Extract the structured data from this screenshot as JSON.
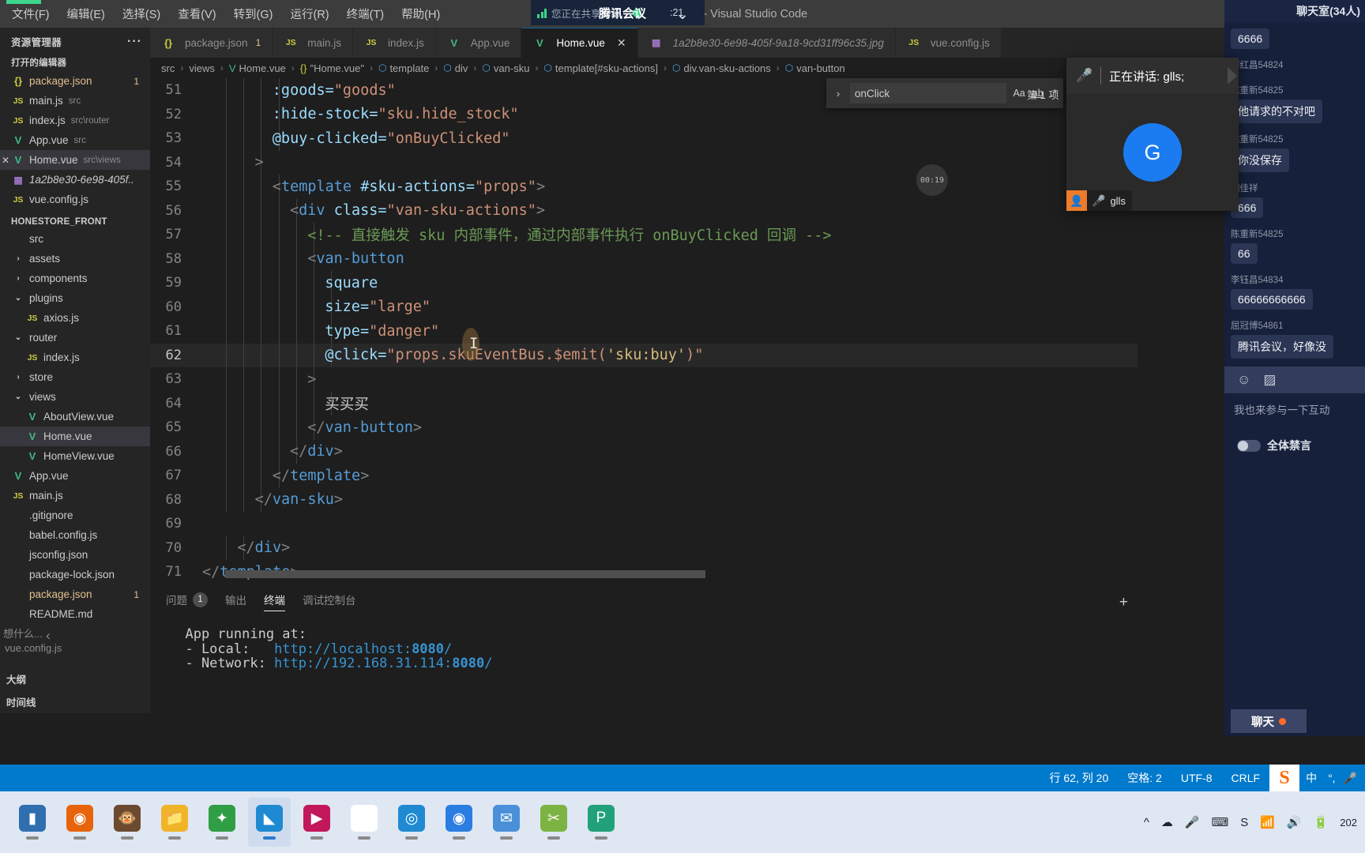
{
  "titlebar": {
    "menus": [
      "文件(F)",
      "编辑(E)",
      "选择(S)",
      "查看(V)",
      "转到(G)",
      "运行(R)",
      "终端(T)",
      "帮助(H)"
    ],
    "window_title": "Home.vue - honestore_front - Visual Studio Code",
    "minimize": "—",
    "maximize": "□",
    "close": "✕"
  },
  "meeting_pill": {
    "sharing_text": "您正在共享屏幕",
    "app_name": "腾讯会议",
    "timer": ":21",
    "chevron": "⌄"
  },
  "explorer": {
    "header": "资源管理器",
    "more": "···",
    "open_editors_label": "打开的编辑器",
    "open_editors": [
      {
        "icon": "json-icon",
        "name": "package.json",
        "desc": "",
        "badge": "1",
        "selected": false,
        "kind": "json"
      },
      {
        "icon": "js-icon",
        "name": "main.js",
        "desc": "src",
        "badge": "",
        "selected": false,
        "kind": "js"
      },
      {
        "icon": "js-icon",
        "name": "index.js",
        "desc": "src\\router",
        "badge": "",
        "selected": false,
        "kind": "js"
      },
      {
        "icon": "vue-icon",
        "name": "App.vue",
        "desc": "src",
        "badge": "",
        "selected": false,
        "kind": "vue"
      },
      {
        "icon": "vue-icon",
        "name": "Home.vue",
        "desc": "src\\views",
        "badge": "",
        "selected": true,
        "kind": "vue"
      },
      {
        "icon": "image-icon",
        "name": "1a2b8e30-6e98-405f..",
        "desc": "",
        "badge": "",
        "selected": false,
        "kind": "img"
      },
      {
        "icon": "js-icon",
        "name": "vue.config.js",
        "desc": "",
        "badge": "",
        "selected": false,
        "kind": "js"
      }
    ],
    "project_label": "HONESTORE_FRONT",
    "tree": [
      {
        "indent": 0,
        "chev": "",
        "icon": "",
        "name": "src",
        "badge": "",
        "kind": "folder",
        "selected": false
      },
      {
        "indent": 0,
        "chev": "›",
        "icon": "",
        "name": "assets",
        "badge": "",
        "kind": "folder",
        "selected": false
      },
      {
        "indent": 0,
        "chev": "›",
        "icon": "",
        "name": "components",
        "badge": "",
        "kind": "folder",
        "selected": false
      },
      {
        "indent": 0,
        "chev": "⌄",
        "icon": "",
        "name": "plugins",
        "badge": "",
        "kind": "folder",
        "selected": false
      },
      {
        "indent": 1,
        "chev": "",
        "icon": "js-icon",
        "name": "axios.js",
        "badge": "",
        "kind": "js",
        "selected": false
      },
      {
        "indent": 0,
        "chev": "⌄",
        "icon": "",
        "name": "router",
        "badge": "",
        "kind": "folder",
        "selected": false
      },
      {
        "indent": 1,
        "chev": "",
        "icon": "js-icon",
        "name": "index.js",
        "badge": "",
        "kind": "js",
        "selected": false
      },
      {
        "indent": 0,
        "chev": "›",
        "icon": "",
        "name": "store",
        "badge": "",
        "kind": "folder",
        "selected": false
      },
      {
        "indent": 0,
        "chev": "⌄",
        "icon": "",
        "name": "views",
        "badge": "",
        "kind": "folder",
        "selected": false
      },
      {
        "indent": 1,
        "chev": "",
        "icon": "vue-icon",
        "name": "AboutView.vue",
        "badge": "",
        "kind": "vue",
        "selected": false
      },
      {
        "indent": 1,
        "chev": "",
        "icon": "vue-icon",
        "name": "Home.vue",
        "badge": "",
        "kind": "vue",
        "selected": true
      },
      {
        "indent": 1,
        "chev": "",
        "icon": "vue-icon",
        "name": "HomeView.vue",
        "badge": "",
        "kind": "vue",
        "selected": false
      },
      {
        "indent": 0,
        "chev": "",
        "icon": "vue-icon",
        "name": "App.vue",
        "badge": "",
        "kind": "vue",
        "selected": false
      },
      {
        "indent": 0,
        "chev": "",
        "icon": "js-icon",
        "name": "main.js",
        "badge": "",
        "kind": "js",
        "selected": false
      },
      {
        "indent": 0,
        "chev": "",
        "icon": "",
        "name": ".gitignore",
        "badge": "",
        "kind": "plain",
        "selected": false
      },
      {
        "indent": 0,
        "chev": "",
        "icon": "",
        "name": "babel.config.js",
        "badge": "",
        "kind": "plain",
        "selected": false
      },
      {
        "indent": 0,
        "chev": "",
        "icon": "",
        "name": "jsconfig.json",
        "badge": "",
        "kind": "plain",
        "selected": false
      },
      {
        "indent": 0,
        "chev": "",
        "icon": "",
        "name": "package-lock.json",
        "badge": "",
        "kind": "plain",
        "selected": false
      },
      {
        "indent": 0,
        "chev": "",
        "icon": "",
        "name": "package.json",
        "badge": "1",
        "kind": "json",
        "selected": false
      },
      {
        "indent": 0,
        "chev": "",
        "icon": "",
        "name": "README.md",
        "badge": "",
        "kind": "plain",
        "selected": false
      }
    ],
    "bottom_sections": [
      "大纲",
      "时间线"
    ],
    "ghost_texts": [
      "想什么...",
      "vue.config.js",
      "‹"
    ]
  },
  "tabs": [
    {
      "icon": "json-icon",
      "label": "package.json",
      "badge": "1",
      "active": false,
      "closable": false
    },
    {
      "icon": "js-icon",
      "label": "main.js",
      "badge": "",
      "active": false,
      "closable": false
    },
    {
      "icon": "js-icon",
      "label": "index.js",
      "badge": "",
      "active": false,
      "closable": false
    },
    {
      "icon": "vue-icon",
      "label": "App.vue",
      "badge": "",
      "active": false,
      "closable": false
    },
    {
      "icon": "vue-icon",
      "label": "Home.vue",
      "badge": "",
      "active": true,
      "closable": true
    },
    {
      "icon": "image-icon",
      "label": "1a2b8e30-6e98-405f-9a18-9cd31ff96c35.jpg",
      "badge": "",
      "active": false,
      "closable": false
    },
    {
      "icon": "js-icon",
      "label": "vue.config.js",
      "badge": "",
      "active": false,
      "closable": false
    }
  ],
  "breadcrumb": [
    {
      "label": "src",
      "icon": ""
    },
    {
      "label": "views",
      "icon": ""
    },
    {
      "label": "Home.vue",
      "icon": "vue-icon"
    },
    {
      "label": "\"Home.vue\"",
      "icon": "json-icon"
    },
    {
      "label": "template",
      "icon": "cube-icon"
    },
    {
      "label": "div",
      "icon": "cube-icon"
    },
    {
      "label": "van-sku",
      "icon": "cube-icon"
    },
    {
      "label": "template[#sku-actions]",
      "icon": "cube-icon"
    },
    {
      "label": "div.van-sku-actions",
      "icon": "cube-icon"
    },
    {
      "label": "van-button",
      "icon": "cube-icon"
    }
  ],
  "find_widget": {
    "chevron": "›",
    "query": "onClick",
    "match_case": "Aa",
    "whole_word": "ab",
    "regex": ".*",
    "result_count": "第 1 项"
  },
  "editor": {
    "hover_tooltip": "00:19",
    "lines": [
      {
        "num": "51",
        "indent": 4,
        "current": false,
        "tokens": [
          {
            "t": "attr",
            "v": ":goods="
          },
          {
            "t": "str",
            "v": "\"goods\""
          }
        ]
      },
      {
        "num": "52",
        "indent": 4,
        "current": false,
        "tokens": [
          {
            "t": "attr",
            "v": ":hide-stock="
          },
          {
            "t": "str",
            "v": "\"sku.hide_stock\""
          }
        ]
      },
      {
        "num": "53",
        "indent": 4,
        "current": false,
        "tokens": [
          {
            "t": "attr",
            "v": "@buy-clicked="
          },
          {
            "t": "str",
            "v": "\"onBuyClicked\""
          }
        ]
      },
      {
        "num": "54",
        "indent": 3,
        "current": false,
        "tokens": [
          {
            "t": "brk",
            "v": ">"
          }
        ]
      },
      {
        "num": "55",
        "indent": 4,
        "current": false,
        "tokens": [
          {
            "t": "brk",
            "v": "<"
          },
          {
            "t": "tag",
            "v": "template"
          },
          {
            "t": "txt",
            "v": " "
          },
          {
            "t": "attr",
            "v": "#sku-actions="
          },
          {
            "t": "str",
            "v": "\"props\""
          },
          {
            "t": "brk",
            "v": ">"
          }
        ]
      },
      {
        "num": "56",
        "indent": 5,
        "current": false,
        "tokens": [
          {
            "t": "brk",
            "v": "<"
          },
          {
            "t": "tag",
            "v": "div"
          },
          {
            "t": "txt",
            "v": " "
          },
          {
            "t": "attr",
            "v": "class="
          },
          {
            "t": "str",
            "v": "\"van-sku-actions\""
          },
          {
            "t": "brk",
            "v": ">"
          }
        ]
      },
      {
        "num": "57",
        "indent": 6,
        "current": false,
        "tokens": [
          {
            "t": "cmt",
            "v": "<!-- 直接触发 sku 内部事件，通过内部事件执行 onBuyClicked 回调 -->"
          }
        ]
      },
      {
        "num": "58",
        "indent": 6,
        "current": false,
        "tokens": [
          {
            "t": "brk",
            "v": "<"
          },
          {
            "t": "tag",
            "v": "van-button"
          }
        ]
      },
      {
        "num": "59",
        "indent": 7,
        "current": false,
        "tokens": [
          {
            "t": "attr",
            "v": "square"
          }
        ]
      },
      {
        "num": "60",
        "indent": 7,
        "current": false,
        "tokens": [
          {
            "t": "attr",
            "v": "size="
          },
          {
            "t": "str",
            "v": "\"large\""
          }
        ]
      },
      {
        "num": "61",
        "indent": 7,
        "current": false,
        "tokens": [
          {
            "t": "attr",
            "v": "type="
          },
          {
            "t": "str",
            "v": "\"danger\""
          }
        ]
      },
      {
        "num": "62",
        "indent": 7,
        "current": true,
        "tokens": [
          {
            "t": "attr",
            "v": "@click="
          },
          {
            "t": "str",
            "v": "\"props.skuEventBus.$emit("
          },
          {
            "t": "yel",
            "v": "'sku:buy'"
          },
          {
            "t": "str",
            "v": ")\""
          }
        ]
      },
      {
        "num": "63",
        "indent": 6,
        "current": false,
        "tokens": [
          {
            "t": "brk",
            "v": ">"
          }
        ]
      },
      {
        "num": "64",
        "indent": 7,
        "current": false,
        "tokens": [
          {
            "t": "txt",
            "v": "买买买"
          }
        ]
      },
      {
        "num": "65",
        "indent": 6,
        "current": false,
        "tokens": [
          {
            "t": "brk",
            "v": "</"
          },
          {
            "t": "tag",
            "v": "van-button"
          },
          {
            "t": "brk",
            "v": ">"
          }
        ]
      },
      {
        "num": "66",
        "indent": 5,
        "current": false,
        "tokens": [
          {
            "t": "brk",
            "v": "</"
          },
          {
            "t": "tag",
            "v": "div"
          },
          {
            "t": "brk",
            "v": ">"
          }
        ]
      },
      {
        "num": "67",
        "indent": 4,
        "current": false,
        "tokens": [
          {
            "t": "brk",
            "v": "</"
          },
          {
            "t": "tag",
            "v": "template"
          },
          {
            "t": "brk",
            "v": ">"
          }
        ]
      },
      {
        "num": "68",
        "indent": 3,
        "current": false,
        "tokens": [
          {
            "t": "brk",
            "v": "</"
          },
          {
            "t": "tag",
            "v": "van-sku"
          },
          {
            "t": "brk",
            "v": ">"
          }
        ]
      },
      {
        "num": "69",
        "indent": 0,
        "current": false,
        "tokens": []
      },
      {
        "num": "70",
        "indent": 2,
        "current": false,
        "tokens": [
          {
            "t": "brk",
            "v": "</"
          },
          {
            "t": "tag",
            "v": "div"
          },
          {
            "t": "brk",
            "v": ">"
          }
        ]
      },
      {
        "num": "71",
        "indent": 0,
        "current": false,
        "tokens": [
          {
            "t": "brk",
            "v": "</"
          },
          {
            "t": "tag",
            "v": "template"
          },
          {
            "t": "brk",
            "v": ">"
          }
        ]
      }
    ]
  },
  "panel": {
    "tabs": [
      {
        "label": "问题",
        "badge": "1",
        "active": false
      },
      {
        "label": "输出",
        "badge": "",
        "active": false
      },
      {
        "label": "终端",
        "badge": "",
        "active": true
      },
      {
        "label": "调试控制台",
        "badge": "",
        "active": false
      }
    ],
    "add": "+",
    "terminal_lines": [
      {
        "pre": "  App running at:",
        "url": "",
        "port": "",
        "post": ""
      },
      {
        "pre": "  - Local:   ",
        "url": "http://localhost:",
        "port": "8080",
        "post": "/"
      },
      {
        "pre": "  - Network: ",
        "url": "http://192.168.31.114:",
        "port": "8080",
        "post": "/"
      }
    ]
  },
  "statusbar": {
    "cursor": "行 62, 列 20",
    "spaces": "空格: 2",
    "encoding": "UTF-8",
    "eol": "CRLF",
    "sogou_logo": "S",
    "ime_mode": "中",
    "ime_punct": "°,",
    "mic": "🎤"
  },
  "meeting_panel": {
    "room_title": "聊天室(34人)",
    "messages": [
      {
        "who": "",
        "text": "6666"
      },
      {
        "who": "李红昌54824",
        "text": ""
      },
      {
        "who": "陈重新54825",
        "text": "他请求的不对吧"
      },
      {
        "who": "陈重新54825",
        "text": "你没保存"
      },
      {
        "who": "刘佳祥",
        "text": "666"
      },
      {
        "who": "陈重新54825",
        "text": "66"
      },
      {
        "who": "李钰昌54834",
        "text": "66666666666"
      },
      {
        "who": "屈冠博54861",
        "text": "腾讯会议，好像没"
      }
    ],
    "tool_emoji": "☺",
    "tool_image": "▨",
    "input_placeholder": "我也来参与一下互动",
    "mute_all_label": "全体禁言",
    "chat_button": "聊天"
  },
  "speaker_window": {
    "mic_icon": "speaking-mic-icon",
    "status_text": "正在讲话: glls;",
    "avatar_letter": "G",
    "footer_name": "glls"
  },
  "taskbar": {
    "apps": [
      {
        "name": "file-explorer-dark-icon",
        "glyph": "▮",
        "color": "#2f6fb0",
        "active": false
      },
      {
        "name": "firefox-icon",
        "glyph": "◉",
        "color": "#e8640c",
        "active": false
      },
      {
        "name": "monkey-app-icon",
        "glyph": "🐵",
        "color": "#6b4a2f",
        "active": false
      },
      {
        "name": "file-explorer-icon",
        "glyph": "📁",
        "color": "#f0b429",
        "active": false
      },
      {
        "name": "store-icon",
        "glyph": "✦",
        "color": "#2f9e44",
        "active": false
      },
      {
        "name": "vscode-icon",
        "glyph": "◣",
        "color": "#1f8ad2",
        "active": true
      },
      {
        "name": "media-player-icon",
        "glyph": "▶",
        "color": "#c2185b",
        "active": false
      },
      {
        "name": "typora-icon",
        "glyph": "T",
        "color": "#ffffff",
        "active": false
      },
      {
        "name": "edge-icon",
        "glyph": "◎",
        "color": "#1f8ad2",
        "active": false
      },
      {
        "name": "tencent-meeting-icon",
        "glyph": "◉",
        "color": "#2a7de1",
        "active": false
      },
      {
        "name": "mail-icon",
        "glyph": "✉",
        "color": "#4a90d9",
        "active": false
      },
      {
        "name": "snipaste-icon",
        "glyph": "✂",
        "color": "#7cb342",
        "active": false
      },
      {
        "name": "pycharm-icon",
        "glyph": "P",
        "color": "#21a179",
        "active": false
      }
    ],
    "tray": [
      "^",
      "☁",
      "🎤",
      "⌨",
      "S",
      "📶",
      "🔊",
      "🔋"
    ],
    "clock": "202"
  }
}
